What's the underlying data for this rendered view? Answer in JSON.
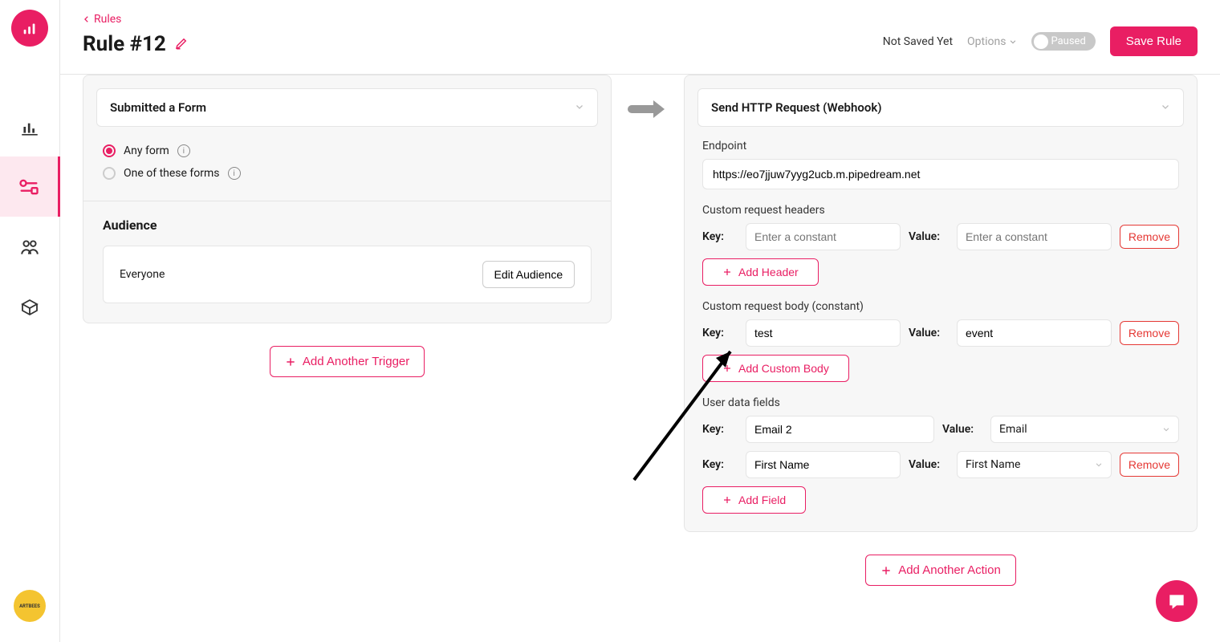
{
  "breadcrumb": {
    "back_label": "Rules"
  },
  "page_title": "Rule #12",
  "header": {
    "not_saved": "Not Saved Yet",
    "options_label": "Options",
    "toggle_label": "Paused",
    "save_label": "Save Rule"
  },
  "trigger": {
    "dropdown_label": "Submitted a Form",
    "radio_any": "Any form",
    "radio_one": "One of these forms",
    "audience_title": "Audience",
    "audience_value": "Everyone",
    "edit_audience_label": "Edit Audience",
    "add_trigger_label": "Add Another Trigger"
  },
  "action": {
    "dropdown_label": "Send HTTP Request (Webhook)",
    "endpoint_label": "Endpoint",
    "endpoint_value": "https://eo7jjuw7yyg2ucb.m.pipedream.net",
    "headers_title": "Custom request headers",
    "key_label": "Key:",
    "value_label": "Value:",
    "header_key_placeholder": "Enter a constant",
    "header_value_placeholder": "Enter a constant",
    "remove_label": "Remove",
    "add_header_label": "Add Header",
    "body_title": "Custom request body (constant)",
    "body_key": "test",
    "body_value": "event",
    "add_body_label": "Add Custom Body",
    "user_fields_title": "User data fields",
    "fields": [
      {
        "key": "Email 2",
        "value": "Email"
      },
      {
        "key": "First Name",
        "value": "First Name"
      }
    ],
    "add_field_label": "Add Field",
    "add_action_label": "Add Another Action"
  },
  "artbees": "ARTBEES"
}
